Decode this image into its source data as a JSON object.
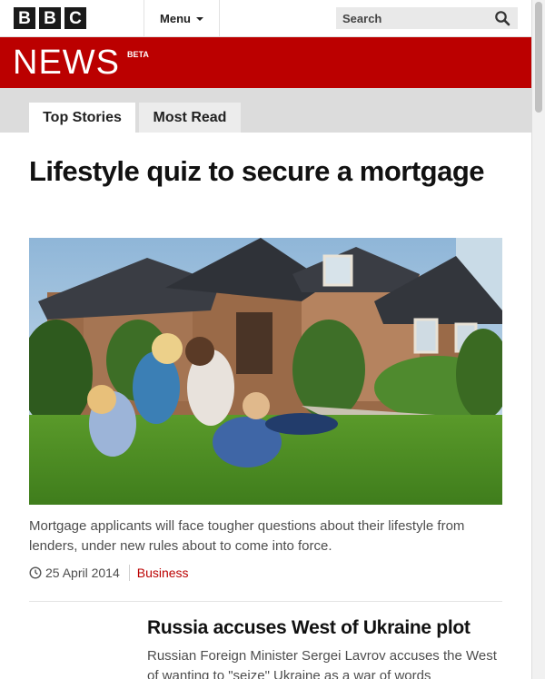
{
  "header": {
    "brand_letters": [
      "B",
      "B",
      "C"
    ],
    "menu_label": "Menu",
    "search_label": "Search"
  },
  "masthead": {
    "title": "NEWS",
    "badge": "BETA"
  },
  "tabs": [
    {
      "label": "Top Stories",
      "active": true
    },
    {
      "label": "Most Read",
      "active": false
    }
  ],
  "top_story": {
    "headline": "Lifestyle quiz to secure a mortgage",
    "summary": "Mortgage applicants will face tougher questions about their lifestyle from lenders, under new rules about to come into force.",
    "date": "25 April 2014",
    "category": "Business"
  },
  "second_story": {
    "headline": "Russia accuses West of Ukraine plot",
    "summary": "Russian Foreign Minister Sergei Lavrov accuses the West of wanting to \"seize\" Ukraine as a war of words"
  },
  "colors": {
    "brand_red": "#bb0000",
    "tab_bar": "#dcdcdc"
  }
}
